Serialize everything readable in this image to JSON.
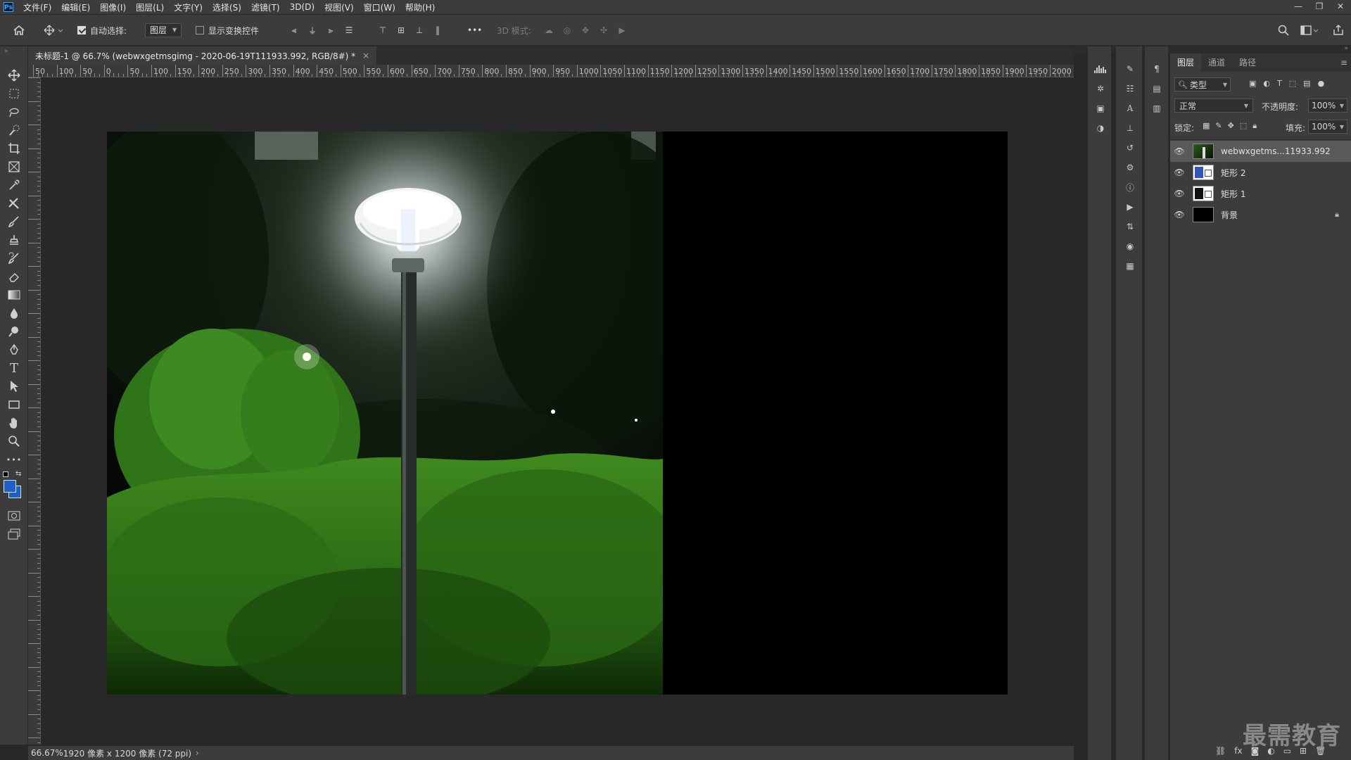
{
  "app": {
    "logo": "Ps"
  },
  "menu": [
    "文件(F)",
    "编辑(E)",
    "图像(I)",
    "图层(L)",
    "文字(Y)",
    "选择(S)",
    "滤镜(T)",
    "3D(D)",
    "视图(V)",
    "窗口(W)",
    "帮助(H)"
  ],
  "window_controls": {
    "minimize": "—",
    "restore": "❐",
    "close": "✕"
  },
  "options": {
    "auto_select_label": "自动选择:",
    "auto_select_checked": true,
    "auto_select_target": "图层",
    "show_transform_label": "显示变换控件",
    "show_transform_checked": false,
    "more": "•••",
    "mode_3d_label": "3D 模式:"
  },
  "document": {
    "tab_title": "未标题-1 @ 66.7% (webwxgetmsgimg - 2020-06-19T111933.992, RGB/8#) *",
    "close": "×"
  },
  "ruler": {
    "top_labels": [
      "50",
      "100",
      "50",
      "0",
      "50",
      "100",
      "150",
      "200",
      "250",
      "300",
      "350",
      "400",
      "450",
      "500",
      "550",
      "600",
      "650",
      "700",
      "750",
      "800",
      "850",
      "900",
      "950",
      "1000",
      "1050",
      "1100",
      "1150",
      "1200",
      "1250",
      "1300",
      "1350",
      "1400",
      "1450",
      "1500",
      "1550",
      "1600",
      "1650",
      "1700",
      "1750",
      "1800",
      "1850",
      "1900",
      "1950",
      "2000"
    ]
  },
  "status": {
    "zoom": "66.67%",
    "info": "1920 像素 x 1200 像素 (72 ppi)",
    "arrow": "›"
  },
  "layers_panel": {
    "tabs": [
      "图层",
      "通道",
      "路径"
    ],
    "active_tab": "图层",
    "filter_label": "类型",
    "blend_mode": "正常",
    "opacity_label": "不透明度:",
    "opacity_value": "100%",
    "lock_label": "锁定:",
    "fill_label": "填充:",
    "fill_value": "100%",
    "layers": [
      {
        "name": "webwxgetms...11933.992",
        "visible": true,
        "selected": true,
        "locked": false
      },
      {
        "name": "矩形 2",
        "visible": true,
        "selected": false,
        "locked": false
      },
      {
        "name": "矩形 1",
        "visible": true,
        "selected": false,
        "locked": false
      },
      {
        "name": "背景",
        "visible": true,
        "selected": false,
        "locked": true
      }
    ]
  },
  "watermark": "最需教育",
  "colors": {
    "foreground": "#1f5fc8",
    "background": "#1f5fc8",
    "ui_bg": "#3c3c3c",
    "canvas_bg": "#282828"
  }
}
